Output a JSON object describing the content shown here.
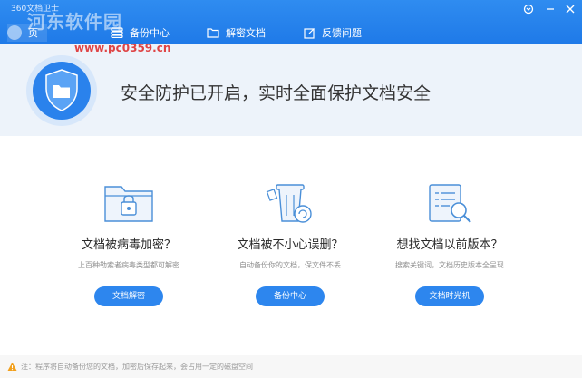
{
  "window": {
    "app_title": "360文档卫士",
    "watermark": "河东软件园",
    "watermark_url": "www.pc0359.cn"
  },
  "nav": {
    "tabs": [
      {
        "label": "页",
        "icon": "home-icon"
      },
      {
        "label": "备份中心",
        "icon": "backup-icon"
      },
      {
        "label": "解密文档",
        "icon": "folder-icon"
      },
      {
        "label": "反馈问题",
        "icon": "edit-icon"
      }
    ],
    "controls": [
      "menu-icon",
      "minimize-icon",
      "close-icon"
    ]
  },
  "hero": {
    "text": "安全防护已开启，实时全面保护文档安全",
    "icon": "shield-folder-icon"
  },
  "cards": [
    {
      "title": "文档被病毒加密？",
      "desc": "上百种勒索者病毒类型都可解密",
      "button": "文档解密",
      "icon": "encrypted-folder-icon"
    },
    {
      "title": "文档被不小心误删？",
      "desc": "自动备份你的文档，保文件不丢",
      "button": "备份中心",
      "icon": "recycle-bin-icon"
    },
    {
      "title": "想找文档以前版本？",
      "desc": "搜索关键词，文档历史版本全呈现",
      "button": "文档时光机",
      "icon": "document-search-icon"
    }
  ],
  "footer": {
    "note": "注：程序将自动备份您的文档，加密后保存起来，会占用一定的磁盘空间",
    "icon": "warning-icon"
  },
  "colors": {
    "brand": "#1f7ae8",
    "button": "#2d86ee",
    "hero_bg": "#edf3fa"
  }
}
